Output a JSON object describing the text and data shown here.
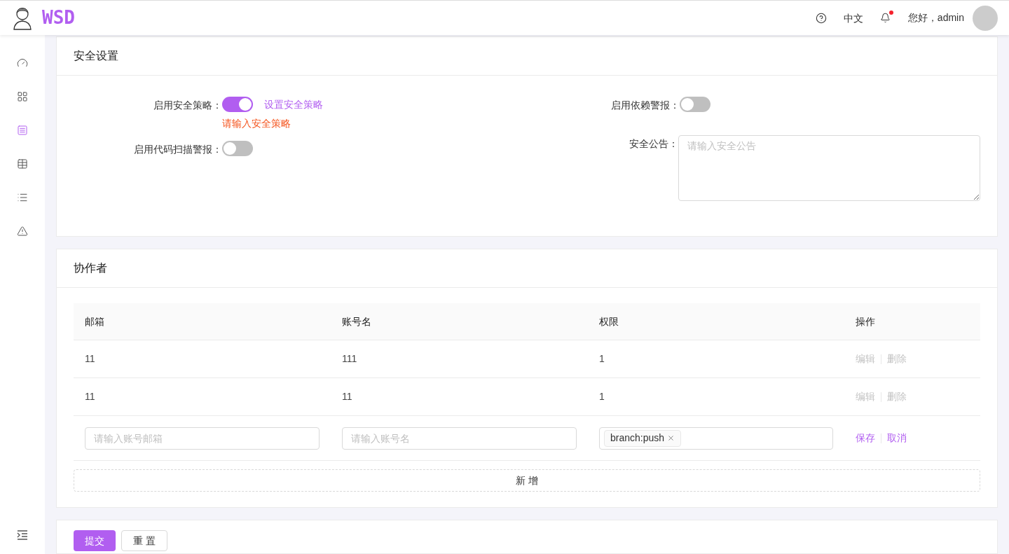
{
  "header": {
    "logo_text": "WSD",
    "language": "中文",
    "notifications": {
      "unread": true
    },
    "greeting": "您好，admin"
  },
  "sidebar": {
    "items": [
      {
        "selected": false
      },
      {
        "selected": false
      },
      {
        "selected": true
      },
      {
        "selected": false
      },
      {
        "selected": false
      },
      {
        "selected": false
      }
    ]
  },
  "security": {
    "title": "安全设置",
    "left": [
      {
        "kind": "switch",
        "label": "启用安全策略：",
        "on": true,
        "link": "设置安全策略",
        "error": "请输入安全策略"
      },
      {
        "kind": "switch",
        "label": "启用代码扫描警报：",
        "on": false
      }
    ],
    "right": [
      {
        "kind": "switch",
        "label": "启用依赖警报：",
        "on": false
      },
      {
        "kind": "textarea",
        "label": "安全公告：",
        "placeholder": "请输入安全公告"
      }
    ]
  },
  "collaborators": {
    "title": "协作者",
    "columns": [
      "邮箱",
      "账号名",
      "权限",
      "操作"
    ],
    "rows": [
      {
        "email": "11",
        "account": "111",
        "permission": "1",
        "actions": [
          {
            "label": "编辑",
            "disabled": true
          },
          {
            "label": "删除",
            "disabled": true
          }
        ]
      },
      {
        "email": "11",
        "account": "11",
        "permission": "1",
        "actions": [
          {
            "label": "编辑",
            "disabled": true
          },
          {
            "label": "删除",
            "disabled": true
          }
        ]
      }
    ],
    "edit_row": {
      "email_placeholder": "请输入账号邮箱",
      "account_placeholder": "请输入账号名",
      "tags": [
        "branch:push"
      ],
      "actions": [
        {
          "label": "保存",
          "disabled": false
        },
        {
          "label": "取消",
          "disabled": false
        }
      ]
    },
    "add_button": "新 增"
  },
  "footer_buttons": [
    {
      "kind": "primary",
      "label": "提交"
    },
    {
      "kind": "default",
      "label": "重 置"
    }
  ]
}
